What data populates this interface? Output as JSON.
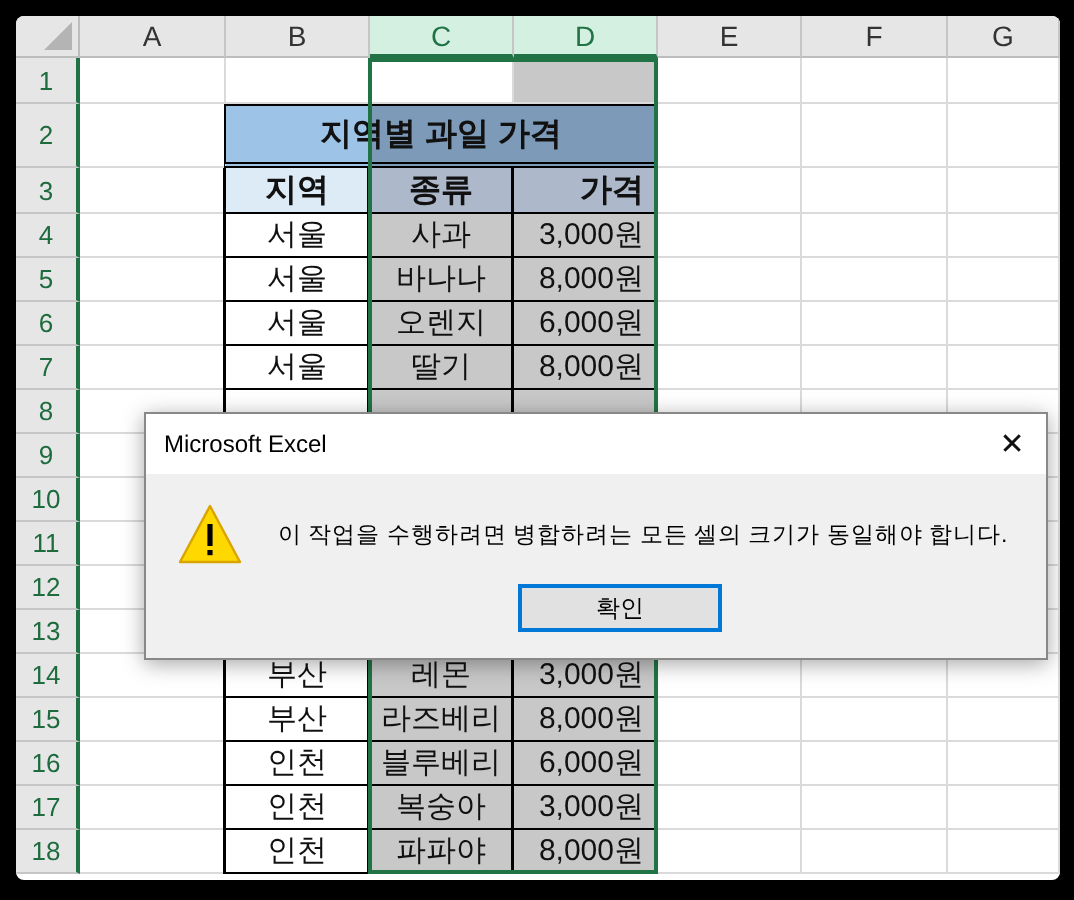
{
  "sheet": {
    "columns": [
      {
        "label": "A",
        "selected": false
      },
      {
        "label": "B",
        "selected": false
      },
      {
        "label": "C",
        "selected": true
      },
      {
        "label": "D",
        "selected": true
      },
      {
        "label": "E",
        "selected": false
      },
      {
        "label": "F",
        "selected": false
      },
      {
        "label": "G",
        "selected": false
      }
    ],
    "rows": [
      {
        "number": "1",
        "kind": "blank",
        "shaded": [
          false,
          false,
          true
        ]
      },
      {
        "number": "2",
        "kind": "title",
        "title": "지역별 과일 가격"
      },
      {
        "number": "3",
        "kind": "header",
        "cells": [
          "지역",
          "종류",
          "가격"
        ]
      },
      {
        "number": "4",
        "kind": "data",
        "cells": [
          "서울",
          "사과",
          "3,000원"
        ]
      },
      {
        "number": "5",
        "kind": "data",
        "cells": [
          "서울",
          "바나나",
          "8,000원"
        ]
      },
      {
        "number": "6",
        "kind": "data",
        "cells": [
          "서울",
          "오렌지",
          "6,000원"
        ]
      },
      {
        "number": "7",
        "kind": "data",
        "cells": [
          "서울",
          "딸기",
          "8,000원"
        ]
      },
      {
        "number": "8",
        "kind": "data"
      },
      {
        "number": "9",
        "kind": "covered"
      },
      {
        "number": "10",
        "kind": "covered"
      },
      {
        "number": "11",
        "kind": "covered"
      },
      {
        "number": "12",
        "kind": "covered"
      },
      {
        "number": "13",
        "kind": "covered"
      },
      {
        "number": "14",
        "kind": "data",
        "cells": [
          "부산",
          "레몬",
          "3,000원"
        ]
      },
      {
        "number": "15",
        "kind": "data",
        "cells": [
          "부산",
          "라즈베리",
          "8,000원"
        ]
      },
      {
        "number": "16",
        "kind": "data",
        "cells": [
          "인천",
          "블루베리",
          "6,000원"
        ]
      },
      {
        "number": "17",
        "kind": "data",
        "cells": [
          "인천",
          "복숭아",
          "3,000원"
        ]
      },
      {
        "number": "18",
        "kind": "data",
        "cells": [
          "인천",
          "파파야",
          "8,000원"
        ]
      }
    ]
  },
  "dialog": {
    "title": "Microsoft Excel",
    "close": "✕",
    "message": "이 작업을 수행하려면 병합하려는 모든 셀의 크기가 동일해야 합니다.",
    "button": "확인"
  }
}
